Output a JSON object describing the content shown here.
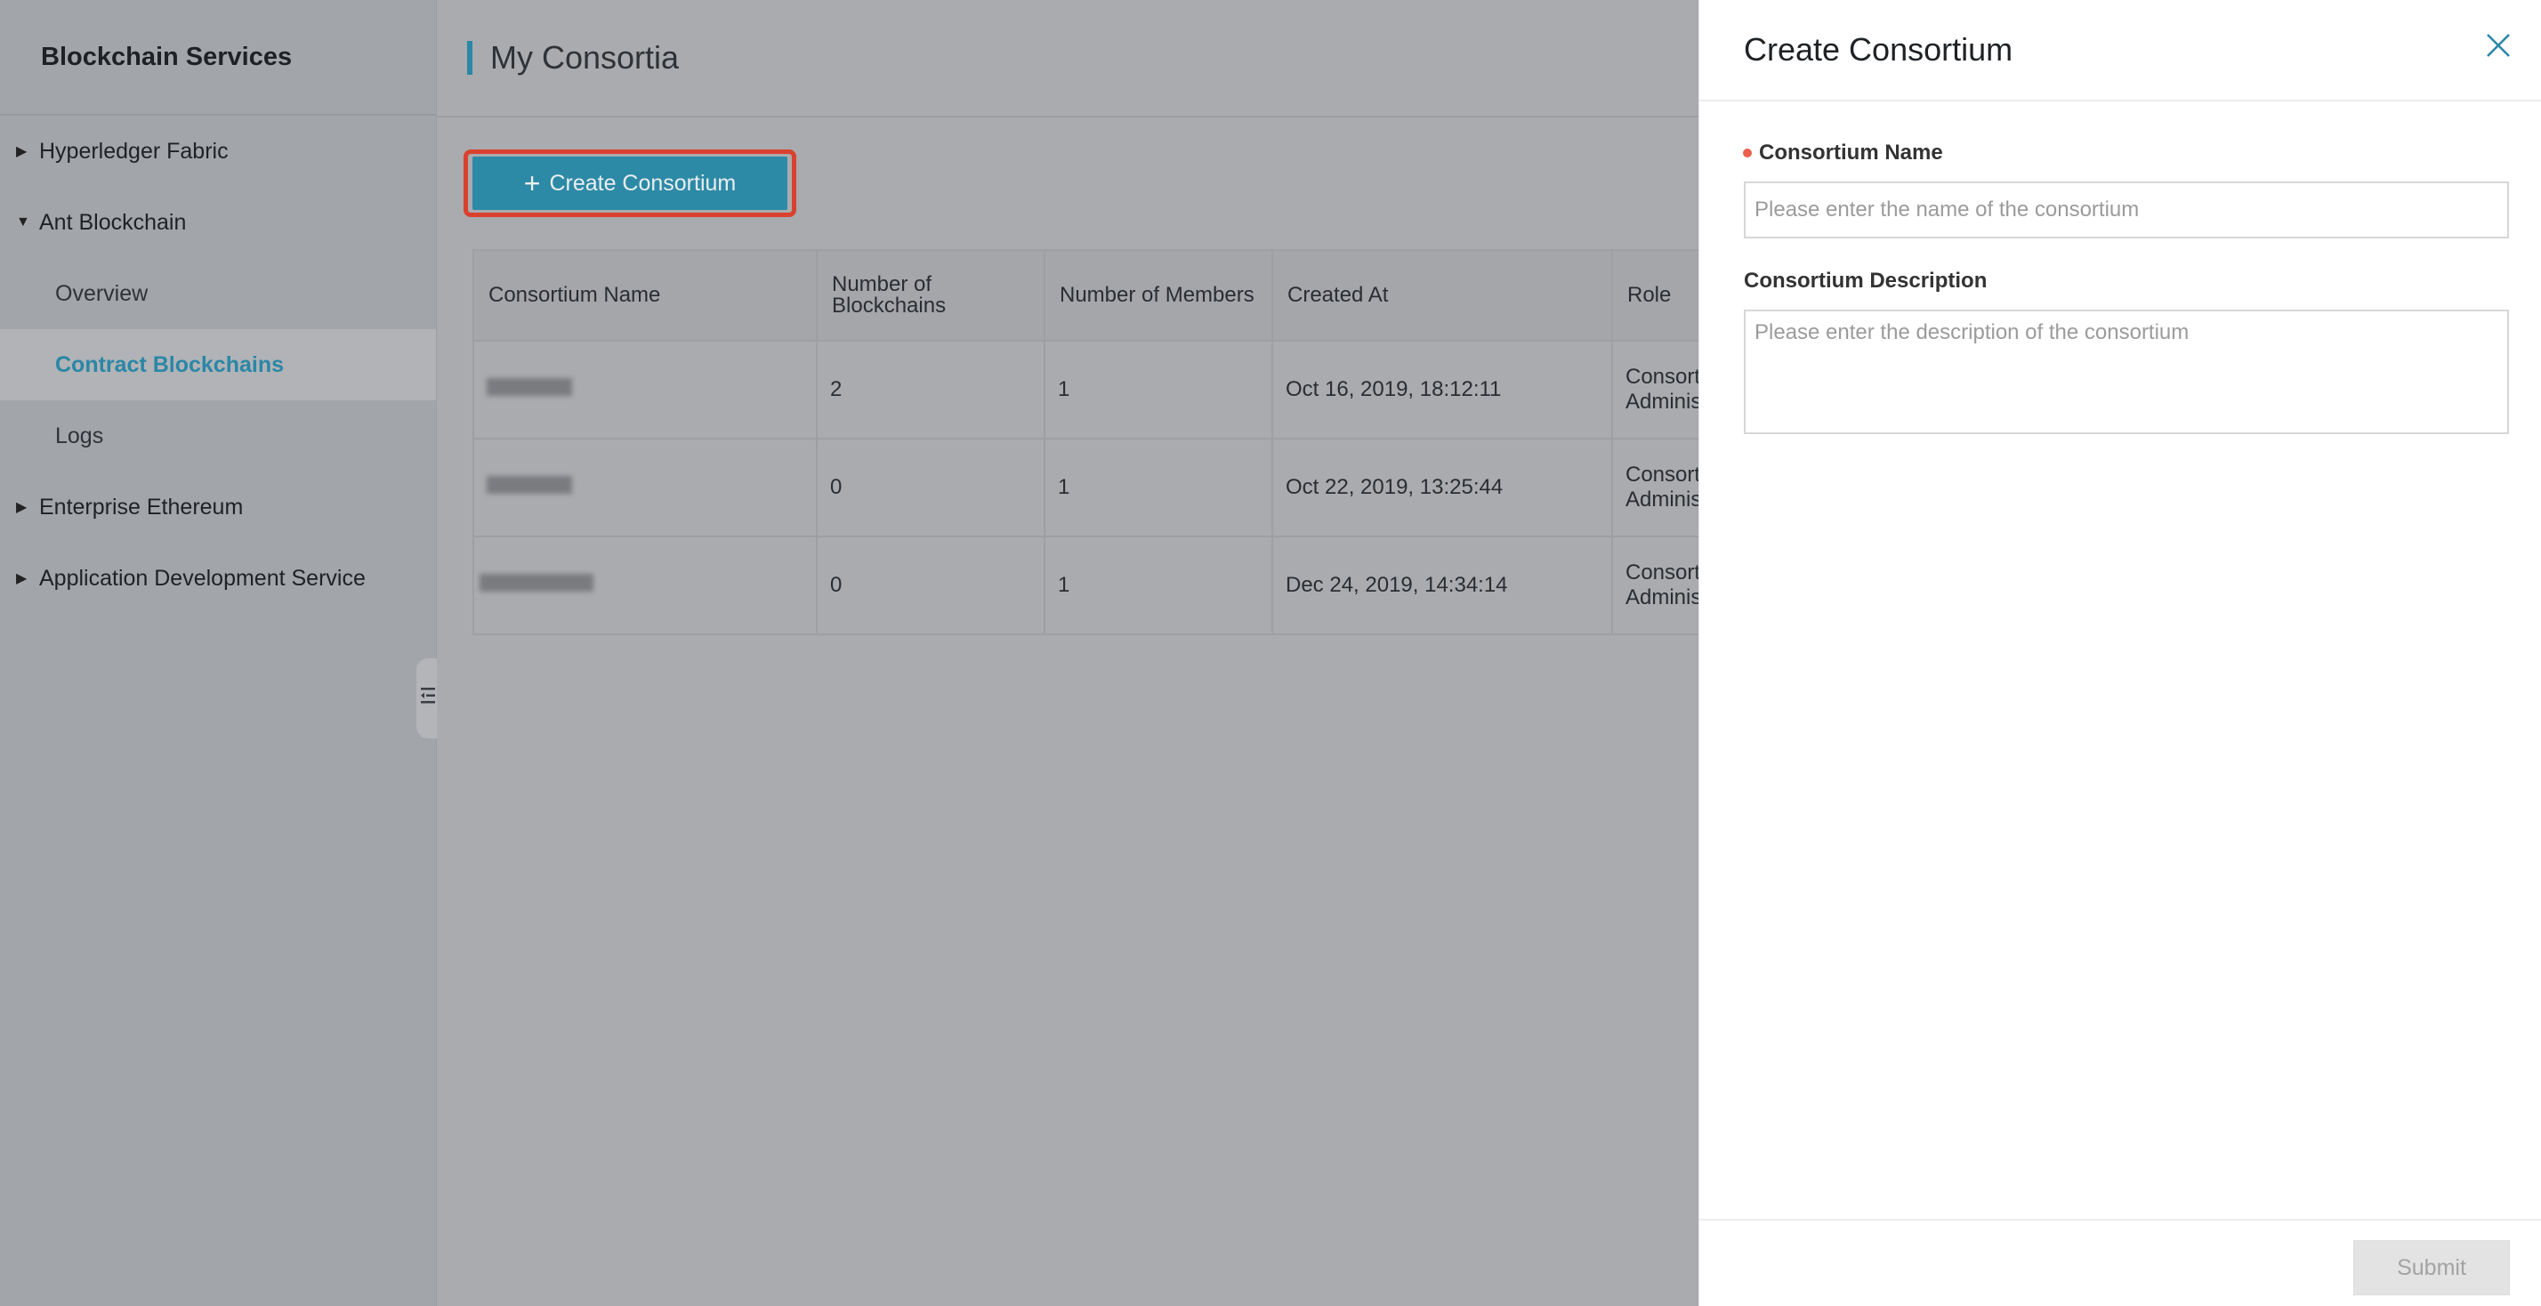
{
  "sidebar": {
    "title": "Blockchain Services",
    "items": [
      {
        "label": "Hyperledger Fabric"
      },
      {
        "label": "Ant Blockchain"
      },
      {
        "label": "Overview"
      },
      {
        "label": "Contract Blockchains"
      },
      {
        "label": "Logs"
      },
      {
        "label": "Enterprise Ethereum"
      },
      {
        "label": "Application Development Service"
      }
    ],
    "collapsed_arrow": "▶",
    "expanded_arrow": "▼"
  },
  "main": {
    "title": "My Consortia",
    "create_button": {
      "icon": "+",
      "label": "Create Consortium"
    },
    "table": {
      "headers": [
        "Consortium Name",
        "Number of Blockchains",
        "Number of Members",
        "Created At",
        "Role"
      ],
      "rows": [
        {
          "blockchains": "2",
          "members": "1",
          "created": "Oct 16, 2019, 18:12:11",
          "role": "Consortium Administrator"
        },
        {
          "blockchains": "0",
          "members": "1",
          "created": "Oct 22, 2019, 13:25:44",
          "role": "Consortium Administrator"
        },
        {
          "blockchains": "0",
          "members": "1",
          "created": "Dec 24, 2019, 14:34:14",
          "role": "Consortium Administrator"
        }
      ]
    }
  },
  "panel": {
    "title": "Create Consortium",
    "name_label": "Consortium Name",
    "name_placeholder": "Please enter the name of the consortium",
    "name_value": "",
    "description_label": "Consortium Description",
    "description_placeholder": "Please enter the description of the consortium",
    "description_value": "",
    "submit_label": "Submit"
  },
  "colors": {
    "accent": "#2a87a6",
    "highlight_border": "#d9412e",
    "required_dot": "#e9604c"
  }
}
